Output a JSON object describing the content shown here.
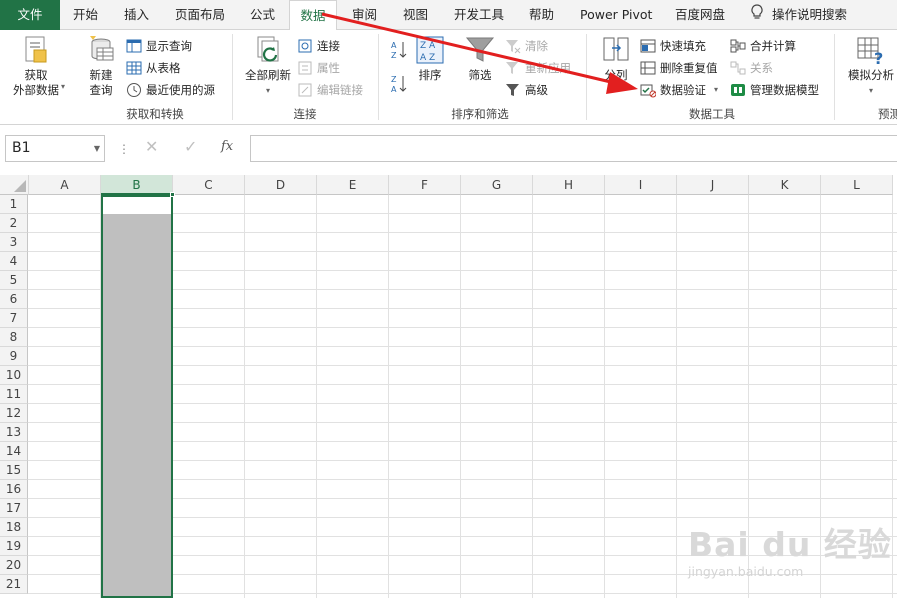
{
  "tabs": {
    "file": "文件",
    "items": [
      "开始",
      "插入",
      "页面布局",
      "公式",
      "数据",
      "审阅",
      "视图",
      "开发工具",
      "帮助",
      "Power Pivot",
      "百度网盘"
    ],
    "active": "数据",
    "tell_me": "操作说明搜索"
  },
  "ribbon": {
    "get_transform": {
      "get_external": "获取\n外部数据",
      "new_query": "新建\n查询",
      "show_queries": "显示查询",
      "from_table": "从表格",
      "recent_sources": "最近使用的源",
      "label": "获取和转换"
    },
    "connections": {
      "refresh_all": "全部刷新",
      "connections": "连接",
      "properties": "属性",
      "edit_links": "编辑链接",
      "label": "连接"
    },
    "sort_filter": {
      "sort": "排序",
      "filter": "筛选",
      "clear": "清除",
      "reapply": "重新应用",
      "advanced": "高级",
      "label": "排序和筛选"
    },
    "data_tools": {
      "text_to_columns": "分列",
      "flash_fill": "快速填充",
      "remove_duplicates": "删除重复值",
      "data_validation": "数据验证",
      "consolidate": "合并计算",
      "relationships": "关系",
      "manage_model": "管理数据模型",
      "label": "数据工具"
    },
    "forecast": {
      "what_if": "模拟分析",
      "label": "预测"
    }
  },
  "formula_bar": {
    "name_box": "B1",
    "fx": "fx",
    "content": ""
  },
  "grid": {
    "columns": [
      "A",
      "B",
      "C",
      "D",
      "E",
      "F",
      "G",
      "H",
      "I",
      "J",
      "K",
      "L"
    ],
    "rows": [
      "1",
      "2",
      "3",
      "4",
      "5",
      "6",
      "7",
      "8",
      "9",
      "10",
      "11",
      "12",
      "13",
      "14",
      "15",
      "16",
      "17",
      "18",
      "19",
      "20",
      "21"
    ],
    "selected_column": "B",
    "active_cell": "B1"
  },
  "watermark": {
    "logo": "Bai du 经验",
    "url": "jingyan.baidu.com"
  },
  "colors": {
    "excel_green": "#217346",
    "arrow_red": "#e21f1f",
    "selection_gray": "#bfbfbf"
  }
}
